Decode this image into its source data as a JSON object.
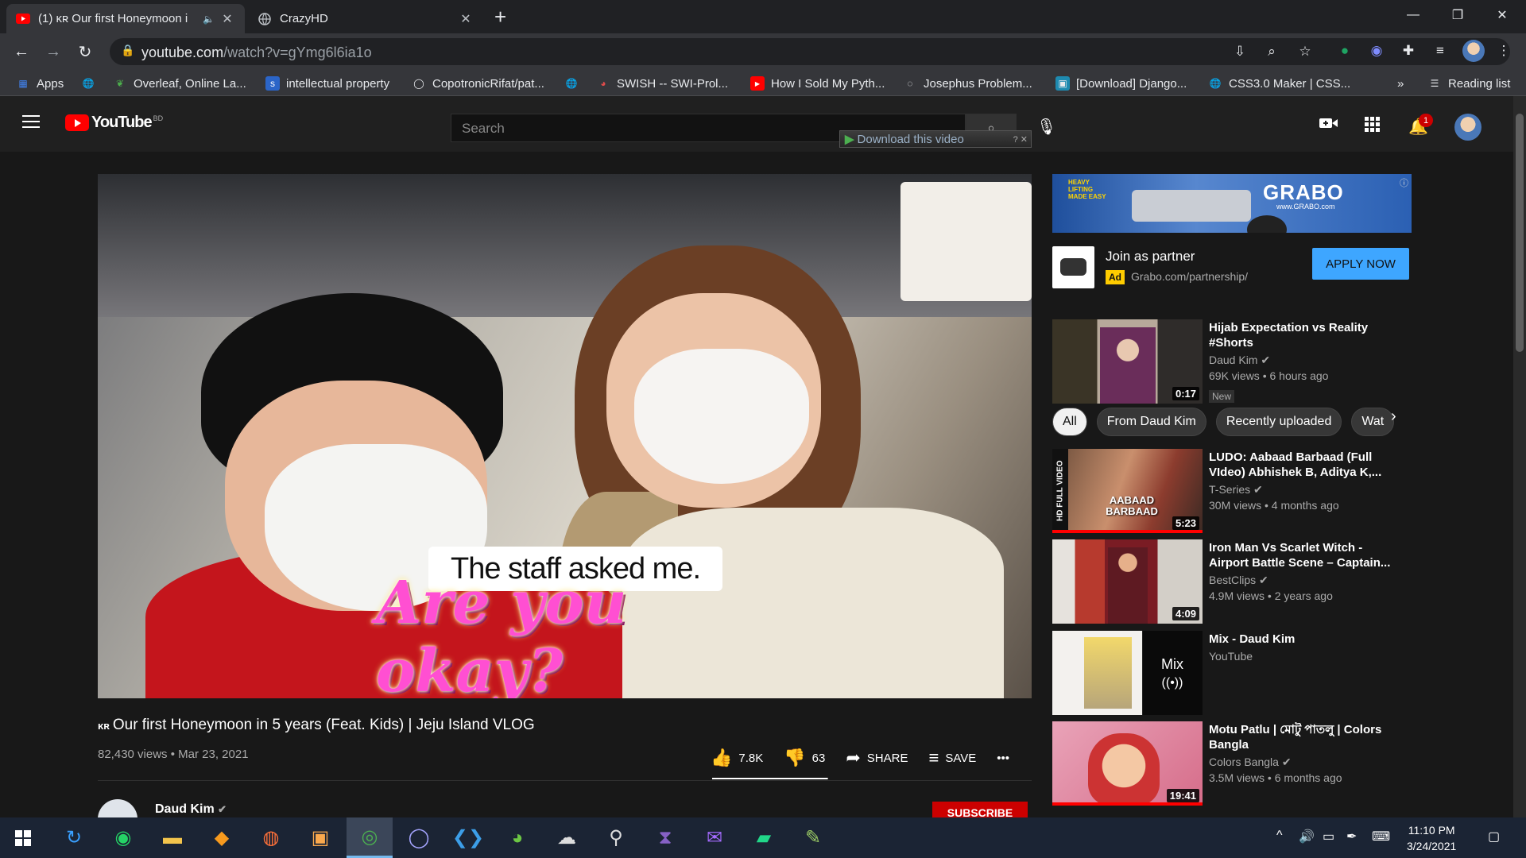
{
  "browser": {
    "tabs": [
      {
        "title": "(1) ᴋʀ Our first Honeymoon i",
        "icon": "youtube-icon"
      },
      {
        "title": "CrazyHD",
        "icon": "globe-icon"
      }
    ],
    "url_host": "youtube.com",
    "url_path": "/watch?v=gYmg6l6ia1o",
    "bookmarks": [
      {
        "label": "Apps",
        "icon": "apps-grid-icon"
      },
      {
        "label": "",
        "icon": "globe-icon"
      },
      {
        "label": "Overleaf, Online La...",
        "icon": "overleaf-icon"
      },
      {
        "label": "intellectual property",
        "icon": "bookmark-s-icon"
      },
      {
        "label": "CopotronicRifat/pat...",
        "icon": "github-icon"
      },
      {
        "label": "",
        "icon": "globe-icon"
      },
      {
        "label": "SWISH -- SWI-Prol...",
        "icon": "swish-icon"
      },
      {
        "label": "How I Sold My Pyth...",
        "icon": "youtube-icon"
      },
      {
        "label": "Josephus Problem...",
        "icon": "loading-icon"
      },
      {
        "label": "[Download] Django...",
        "icon": "download-site-icon"
      },
      {
        "label": "CSS3.0 Maker | CSS...",
        "icon": "globe-icon"
      }
    ],
    "more_bookmarks": "»",
    "reading_list": "Reading list"
  },
  "youtube": {
    "logo_text": "YouTube",
    "country_code": "BD",
    "search_placeholder": "Search",
    "download_video": "Download this video",
    "notification_count": "1",
    "video": {
      "caption_top": "The staff asked me.",
      "caption_bottom": "Are you okay?",
      "country_tag": "ᴋʀ",
      "title": "Our first Honeymoon in 5 years (Feat. Kids) | Jeju Island VLOG",
      "meta": "82,430 views • Mar 23, 2021",
      "likes": "7.8K",
      "dislikes": "63",
      "share": "SHARE",
      "save": "SAVE",
      "more": "•••",
      "like_ratio": 0.992
    },
    "channel": {
      "name": "Daud Kim",
      "subscribe": "SUBSCRIBE"
    },
    "ad": {
      "banner_brand": "GRABO",
      "banner_url": "www.GRABO.com",
      "banner_slogan": "HEAVY LIFTING MADE EASY",
      "title": "Join as partner",
      "tag": "Ad",
      "url": "Grabo.com/partnership/",
      "button": "APPLY NOW"
    },
    "chips": [
      "All",
      "From Daud Kim",
      "Recently uploaded",
      "Wat"
    ],
    "recommendations": [
      {
        "title": "Hijab Expectation vs Reality #Shorts",
        "channel": "Daud Kim",
        "verified": true,
        "views": "69K views • 6 hours ago",
        "duration": "0:17",
        "badge": "New"
      },
      {
        "title": "LUDO: Aabaad Barbaad (Full VIdeo) Abhishek B, Aditya K,...",
        "channel": "T-Series",
        "verified": true,
        "views": "30M views • 4 months ago",
        "duration": "5:23",
        "thumb_text": "AABAAD BARBAAD",
        "side_text": "HD FULL VIDEO"
      },
      {
        "title": "Iron Man Vs Scarlet Witch - Airport Battle Scene – Captain...",
        "channel": "BestClips",
        "verified": true,
        "views": "4.9M views • 2 years ago",
        "duration": "4:09"
      },
      {
        "title": "Mix - Daud Kim",
        "channel": "YouTube",
        "verified": false,
        "views": "",
        "duration": "",
        "mix_label": "Mix"
      },
      {
        "title": "Motu Patlu | মোটু পাতলু | Colors Bangla",
        "channel": "Colors Bangla",
        "verified": true,
        "views": "3.5M views • 6 months ago",
        "duration": "19:41"
      }
    ]
  },
  "taskbar": {
    "time": "11:10 PM",
    "date": "3/24/2021"
  }
}
